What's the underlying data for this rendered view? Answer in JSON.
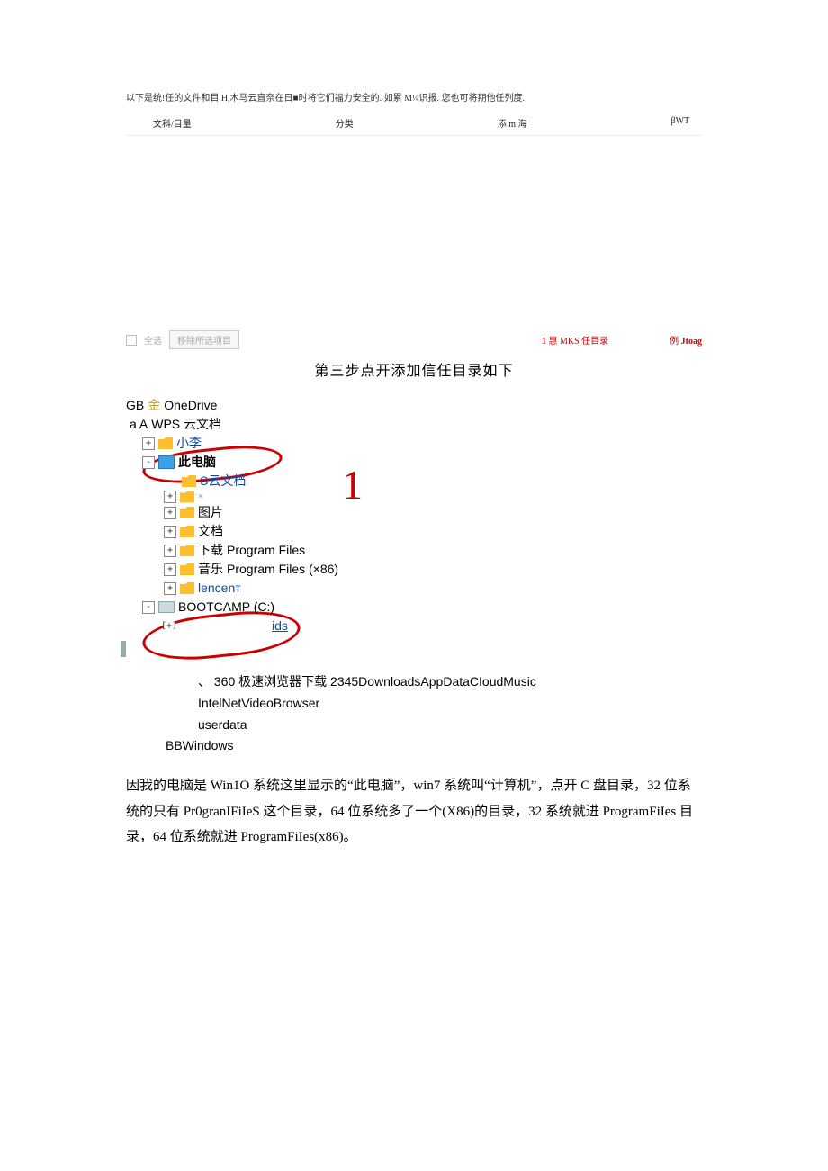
{
  "top_note": "以下是统!任的文件和目 H,木马云直奈在日■时将它们福力安全的. 如累 M¼识报. 您也可将期他任列度.",
  "columns": {
    "c1": "文科/目量",
    "c2": "分类",
    "c3": "添 m 海",
    "c4": "βWT"
  },
  "footer": {
    "checkbox_label": "全选",
    "button_label": "移除所选项目",
    "link1_prefix": "1",
    "link1": "惠 MKS 任目录",
    "link2_prefix": "例",
    "link2": "Jtoag"
  },
  "step3": "第三步点开添加信任目录如下",
  "tree": {
    "line_gb": "GB",
    "onedrive": "OneDrive",
    "line_a": "a A",
    "wps": "WPS 云文档",
    "xiaoli": "小李",
    "this_pc": "此电脑",
    "wps_sub": "S云文档",
    "pic": "图片",
    "doc": "文档",
    "download": "下载",
    "music": "音乐",
    "pf": "Program Files",
    "pf86": "Program Files (×86)",
    "tencent": "lencenт",
    "bootcamp": "BOOTCAMP (C:)",
    "ids": "ids",
    "big1": "1"
  },
  "listblock": {
    "l1_prefix": "、",
    "l1": "360 极速浏览器下载 2345DownloadsAppDataCIoudMusic",
    "l2": "IntelNetVideoBrowser",
    "l3": "userdata",
    "l4": "BBWindows"
  },
  "para": "因我的电脑是 Win1O 系统这里显示的“此电脑”，win7 系统叫“计算机”，点开 C 盘目录，32 位系统的只有 Pr0granIFiIeS 这个目录，64 位系统多了一个(X86)的目录，32 系统就进 ProgramFiIes 目录，64 位系统就进 ProgramFiIes(x86)。"
}
